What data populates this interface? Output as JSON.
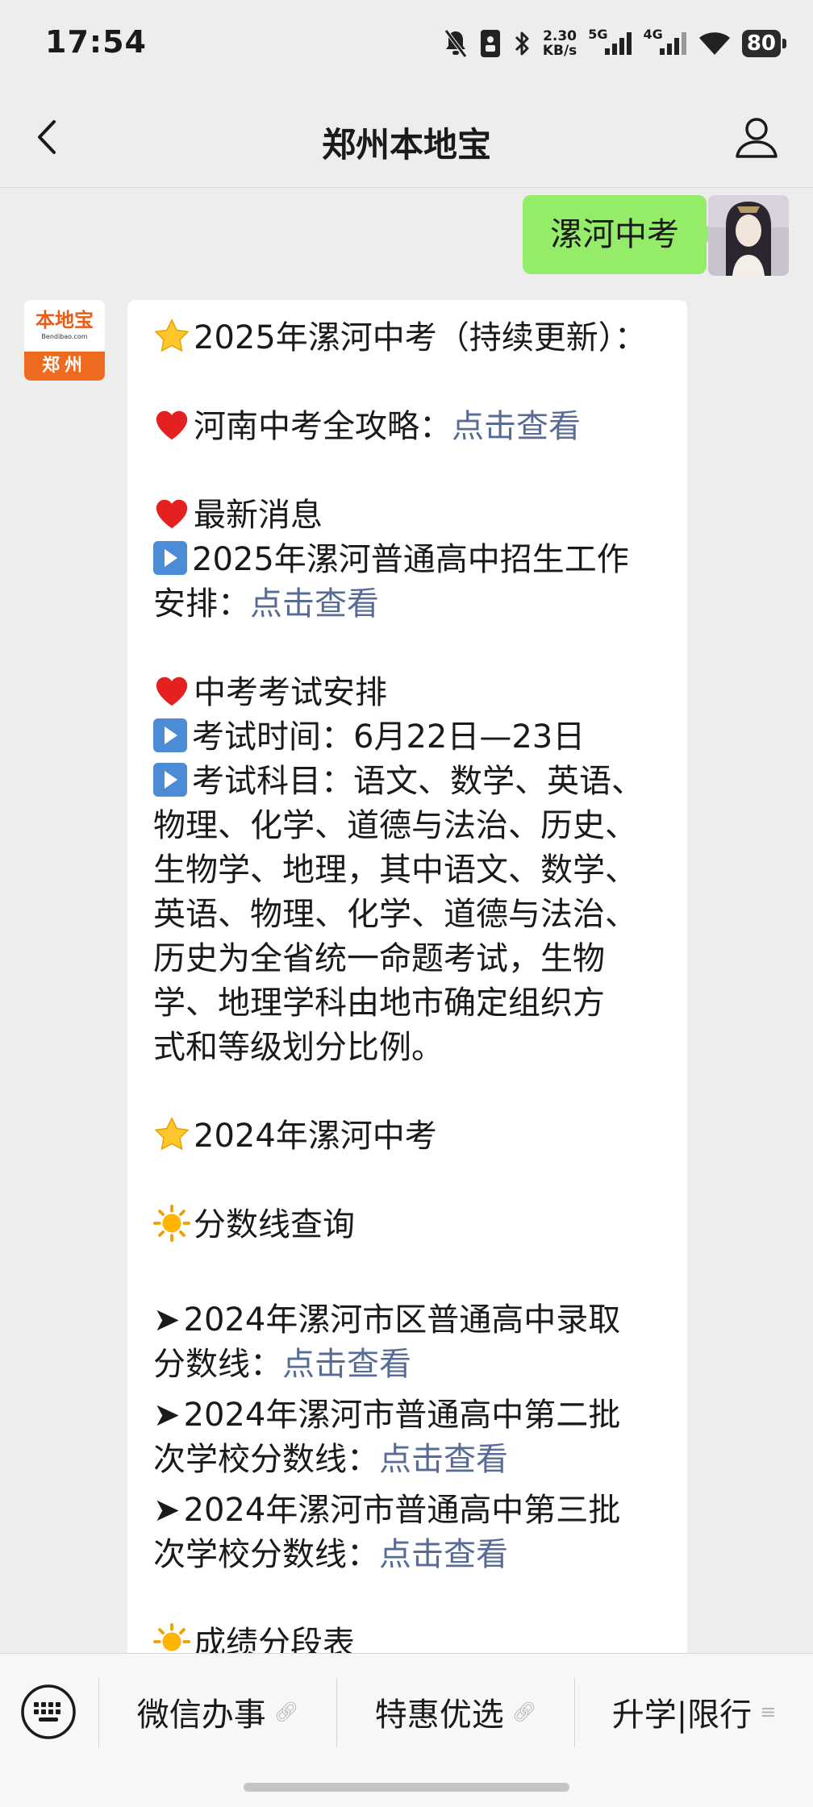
{
  "status_bar": {
    "time": "17:54",
    "net_speed_value": "2.30",
    "net_speed_unit": "KB/s",
    "signal_1_label": "5G",
    "signal_2_label": "4G",
    "battery": "80",
    "icons": [
      "mute-icon",
      "sim-icon",
      "bluetooth-icon",
      "signal-5g-icon",
      "signal-4g-icon",
      "wifi-icon",
      "battery-icon"
    ]
  },
  "header": {
    "title": "郑州本地宝",
    "icons": [
      "back-icon",
      "profile-icon"
    ]
  },
  "chat": {
    "outgoing": {
      "text": "漯河中考"
    },
    "brand_avatar": {
      "name_cn": "本地宝",
      "name_en": "Bendibao.com",
      "city": "郑州"
    },
    "incoming": {
      "l1": "2025年漯河中考（持续更新）：",
      "l2": "河南中考全攻略：",
      "l2_link": "点击查看",
      "l3": "最新消息",
      "l4": "2025年漯河普通高中招生工作",
      "l5": "安排：",
      "l5_link": "点击查看",
      "l6": "中考考试安排",
      "l7": "考试时间：6月22日—23日",
      "l8": "考试科目：语文、数学、英语、",
      "l9": "物理、化学、道德与法治、历史、",
      "l10": "生物学、地理，其中语文、数学、",
      "l11": "英语、物理、化学、道德与法治、",
      "l12": "历史为全省统一命题考试，生物",
      "l13": "学、地理学科由地市确定组织方",
      "l14": "式和等级划分比例。",
      "l15": "2024年漯河中考",
      "l16": "分数线查询",
      "l17": "2024年漯河市区普通高中录取",
      "l18": "分数线：",
      "l18_link": "点击查看",
      "l19": "2024年漯河市普通高中第二批",
      "l20": "次学校分数线：",
      "l20_link": "点击查看",
      "l21": "2024年漯河市普通高中第三批",
      "l22": "次学校分数线：",
      "l22_link": "点击查看",
      "l23": "成绩分段表"
    }
  },
  "bottom_menu": {
    "items": [
      {
        "label": "微信办事"
      },
      {
        "label": "特惠优选"
      },
      {
        "label": "升学|限行"
      }
    ]
  }
}
